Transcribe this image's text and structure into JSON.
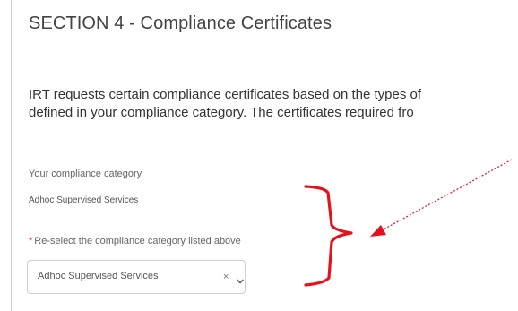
{
  "section": {
    "title": "SECTION 4 - Compliance Certificates"
  },
  "intro": {
    "line1": "IRT requests certain compliance certificates based on the types of",
    "line2": "defined in your compliance category.  The certificates required fro"
  },
  "compliance_category": {
    "label": "Your compliance category",
    "value": "Adhoc Supervised Services"
  },
  "reselect": {
    "required_marker": "*",
    "label": "Re-select the compliance category listed above",
    "selected_value": "Adhoc Supervised Services",
    "clear_icon": "×"
  },
  "colors": {
    "annotation": "#e8101a",
    "required": "#c23934"
  },
  "icons": {
    "clear": "close-icon",
    "dropdown": "chevron-down-icon"
  }
}
